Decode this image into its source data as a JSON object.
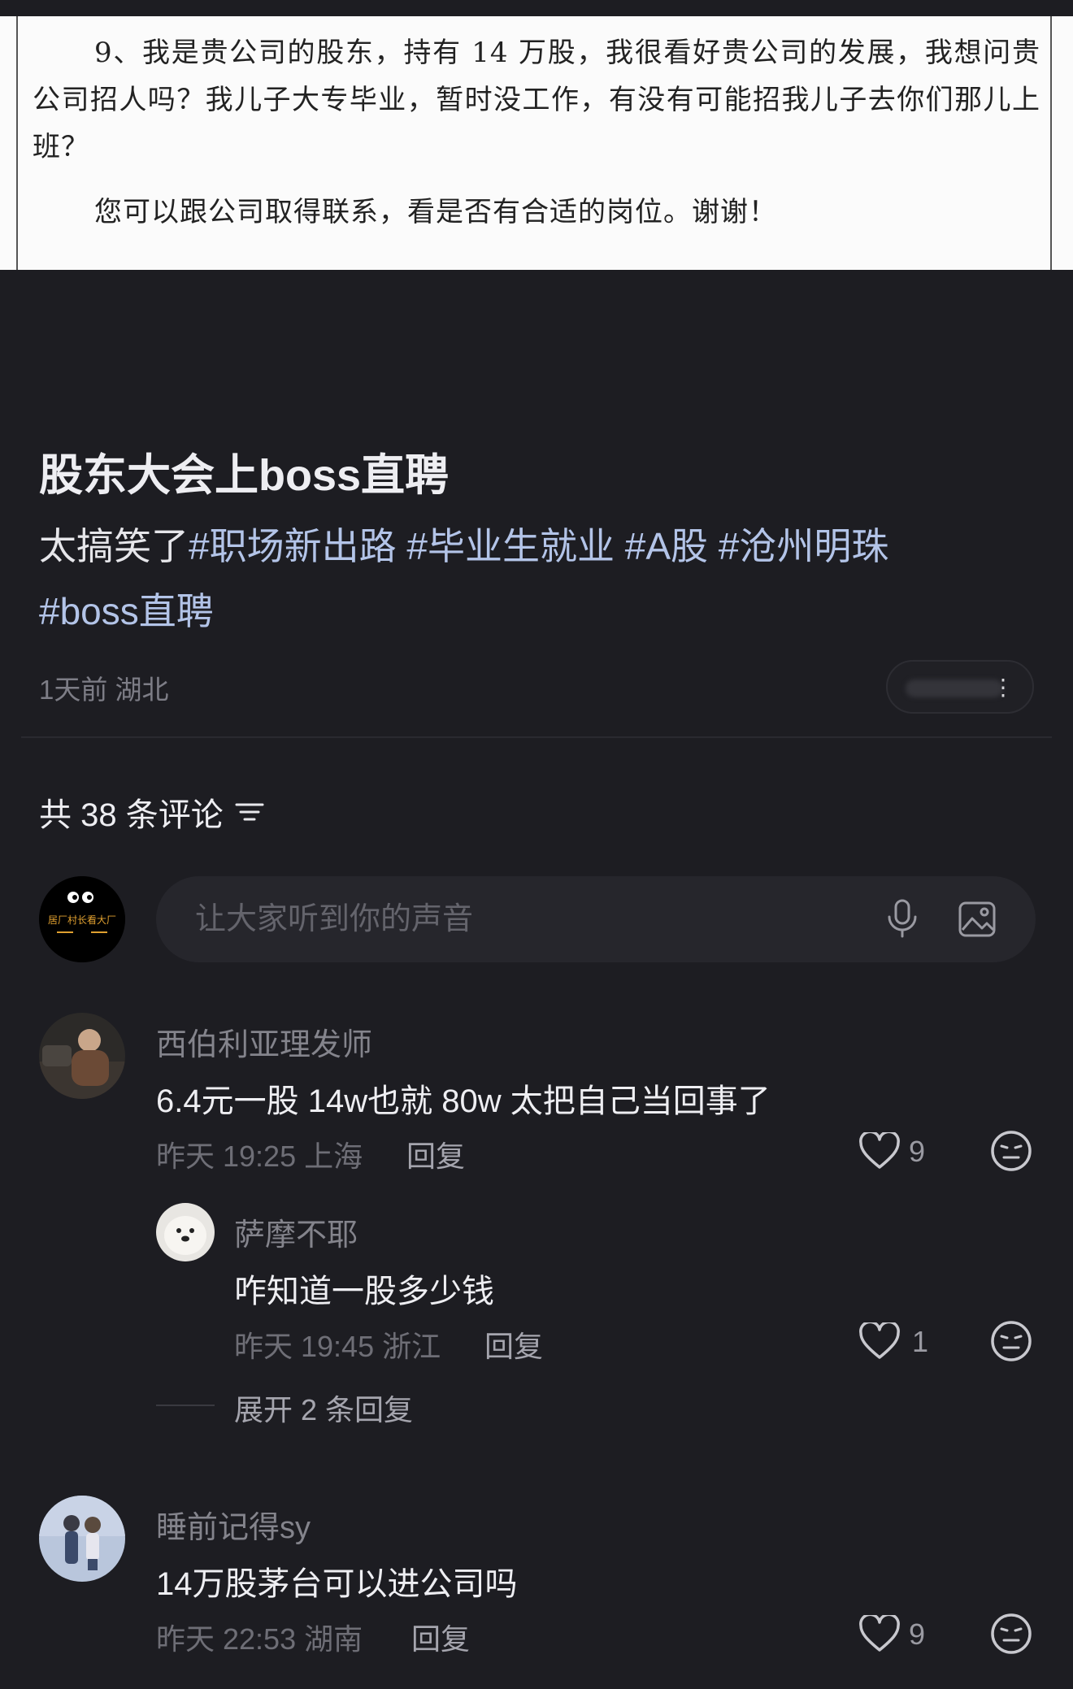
{
  "document_excerpt": {
    "question": "9、我是贵公司的股东，持有 14 万股，我很看好贵公司的发展，我想问贵公司招人吗？我儿子大专毕业，暂时没工作，有没有可能招我儿子去你们那儿上班？",
    "answer": "您可以跟公司取得联系，看是否有合适的岗位。谢谢！"
  },
  "post": {
    "title": "股东大会上boss直聘",
    "body_text": "太搞笑了",
    "tags": [
      "#职场新出路",
      "#毕业生就业",
      "#A股",
      "#沧州明珠",
      "#boss直聘"
    ],
    "time": "1天前",
    "location": "湖北"
  },
  "comments_section": {
    "header": "共 38 条评论",
    "input_placeholder": "让大家听到你的声音",
    "my_avatar_text": "居厂村长看大厂"
  },
  "comments": [
    {
      "user": "西伯利亚理发师",
      "text": "6.4元一股 14w也就 80w 太把自己当回事了",
      "time": "昨天 19:25",
      "location": "上海",
      "reply_label": "回复",
      "likes": "9",
      "replies": [
        {
          "user": "萨摩不耶",
          "text": "咋知道一股多少钱",
          "time": "昨天 19:45",
          "location": "浙江",
          "reply_label": "回复",
          "likes": "1"
        }
      ],
      "expand_label": "展开 2 条回复"
    },
    {
      "user": "睡前记得sy",
      "text": "14万股茅台可以进公司吗",
      "time": "昨天 22:53",
      "location": "湖南",
      "reply_label": "回复",
      "likes": "9"
    }
  ],
  "colors": {
    "background": "#1d1d22",
    "tag": "#b3c4e8",
    "muted": "#6e6e76"
  }
}
